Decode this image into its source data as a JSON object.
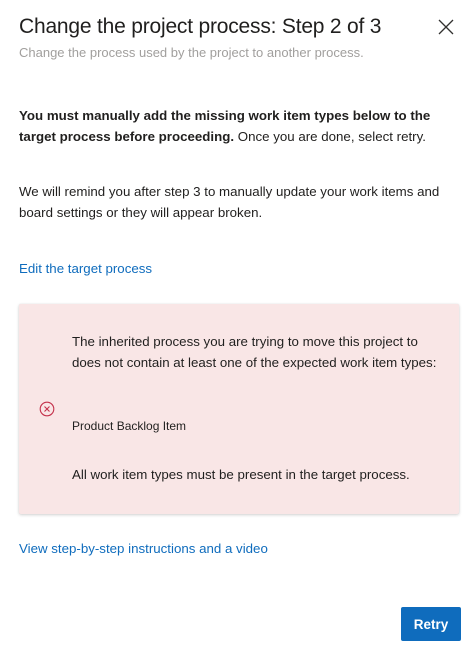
{
  "dialog": {
    "title": "Change the project process: Step 2 of 3",
    "subtitle": "Change the process used by the project to another process.",
    "close_icon": "close-icon"
  },
  "instructions": {
    "bold_text": "You must manually add the missing work item types below to the target process before proceeding.",
    "normal_text": " Once you are done, select retry.",
    "reminder": "We will remind you after step 3 to manually update your work items and board settings or they will appear broken."
  },
  "links": {
    "edit_target": "Edit the target process",
    "instructions_video": "View step-by-step instructions and a video"
  },
  "error": {
    "icon": "error-circle-icon",
    "message": "The inherited process you are trying to move this project to does not contain at least one of the expected work item types:",
    "missing_item": "Product Backlog Item",
    "footer": "All work item types must be present in the target process."
  },
  "actions": {
    "retry_label": "Retry"
  },
  "colors": {
    "accent": "#0f6cbd",
    "error_background": "#f9e6e6",
    "error_icon": "#c4314b",
    "subtitle": "#a19f9d"
  }
}
